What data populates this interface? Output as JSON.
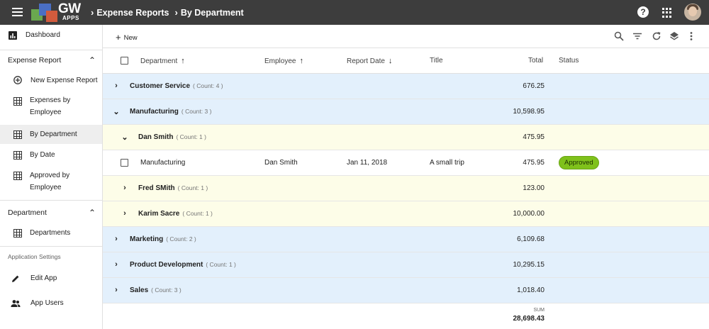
{
  "header": {
    "logo_text": "GW",
    "logo_sub": "APPS",
    "breadcrumbs": [
      {
        "label": "Expense Reports"
      },
      {
        "label": "By Department"
      }
    ],
    "help_label": "?"
  },
  "sidebar": {
    "dashboard": "Dashboard",
    "section_expense": "Expense Report",
    "expense_items": [
      {
        "label": "New Expense Report",
        "icon": "add-circle-icon"
      },
      {
        "label": "Expenses by Employee",
        "icon": "grid-icon"
      },
      {
        "label": "By Department",
        "icon": "grid-icon",
        "active": true
      },
      {
        "label": "By Date",
        "icon": "grid-icon"
      },
      {
        "label": "Approved by Employee",
        "icon": "grid-icon"
      }
    ],
    "section_department": "Department",
    "department_items": [
      {
        "label": "Departments",
        "icon": "grid-icon"
      }
    ],
    "settings_heading": "Application Settings",
    "settings_items": [
      {
        "label": "Edit App",
        "icon": "pencil-icon"
      },
      {
        "label": "App Users",
        "icon": "people-icon"
      }
    ]
  },
  "toolbar": {
    "new_label": "New"
  },
  "grid": {
    "columns": {
      "department": "Department",
      "employee": "Employee",
      "report_date": "Report Date",
      "title": "Title",
      "total": "Total",
      "status": "Status"
    },
    "groups": {
      "customer_service": {
        "name": "Customer Service",
        "count": "( Count: 4 )",
        "total": "676.25"
      },
      "manufacturing": {
        "name": "Manufacturing",
        "count": "( Count: 3 )",
        "total": "10,598.95"
      },
      "dan_smith": {
        "name": "Dan Smith",
        "count": "( Count: 1 )",
        "total": "475.95"
      },
      "fred_smith": {
        "name": "Fred SMith",
        "count": "( Count: 1 )",
        "total": "123.00"
      },
      "karim_sacre": {
        "name": "Karim Sacre",
        "count": "( Count: 1 )",
        "total": "10,000.00"
      },
      "marketing": {
        "name": "Marketing",
        "count": "( Count: 2 )",
        "total": "6,109.68"
      },
      "product_development": {
        "name": "Product Development",
        "count": "( Count: 1 )",
        "total": "10,295.15"
      },
      "sales": {
        "name": "Sales",
        "count": "( Count: 3 )",
        "total": "1,018.40"
      }
    },
    "detail_row": {
      "department": "Manufacturing",
      "employee": "Dan Smith",
      "report_date": "Jan 11, 2018",
      "title": "A small trip",
      "total": "475.95",
      "status": "Approved"
    },
    "footer": {
      "sum_label": "SUM",
      "sum_value": "28,698.43"
    }
  }
}
